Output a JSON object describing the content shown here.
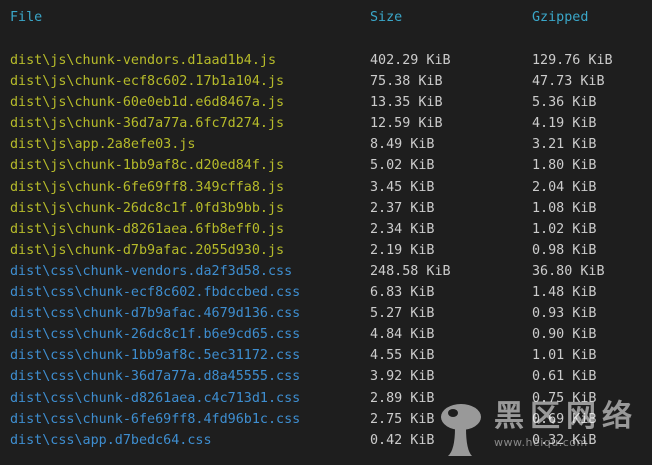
{
  "header": {
    "file_label": "File",
    "size_label": "Size",
    "gzipped_label": "Gzipped"
  },
  "colors": {
    "background": "#1e1e1e",
    "header": "#3aa7c9",
    "js_file": "#b6bb2a",
    "css_file": "#3e8ed0",
    "value": "#cccccc"
  },
  "rows": [
    {
      "file": "dist\\js\\chunk-vendors.d1aad1b4.js",
      "size": "402.29 KiB",
      "gzipped": "129.76 KiB",
      "kind": "js"
    },
    {
      "file": "dist\\js\\chunk-ecf8c602.17b1a104.js",
      "size": "75.38 KiB",
      "gzipped": "47.73 KiB",
      "kind": "js"
    },
    {
      "file": "dist\\js\\chunk-60e0eb1d.e6d8467a.js",
      "size": "13.35 KiB",
      "gzipped": "5.36 KiB",
      "kind": "js"
    },
    {
      "file": "dist\\js\\chunk-36d7a77a.6fc7d274.js",
      "size": "12.59 KiB",
      "gzipped": "4.19 KiB",
      "kind": "js"
    },
    {
      "file": "dist\\js\\app.2a8efe03.js",
      "size": "8.49 KiB",
      "gzipped": "3.21 KiB",
      "kind": "js"
    },
    {
      "file": "dist\\js\\chunk-1bb9af8c.d20ed84f.js",
      "size": "5.02 KiB",
      "gzipped": "1.80 KiB",
      "kind": "js"
    },
    {
      "file": "dist\\js\\chunk-6fe69ff8.349cffa8.js",
      "size": "3.45 KiB",
      "gzipped": "2.04 KiB",
      "kind": "js"
    },
    {
      "file": "dist\\js\\chunk-26dc8c1f.0fd3b9bb.js",
      "size": "2.37 KiB",
      "gzipped": "1.08 KiB",
      "kind": "js"
    },
    {
      "file": "dist\\js\\chunk-d8261aea.6fb8eff0.js",
      "size": "2.34 KiB",
      "gzipped": "1.02 KiB",
      "kind": "js"
    },
    {
      "file": "dist\\js\\chunk-d7b9afac.2055d930.js",
      "size": "2.19 KiB",
      "gzipped": "0.98 KiB",
      "kind": "js"
    },
    {
      "file": "dist\\css\\chunk-vendors.da2f3d58.css",
      "size": "248.58 KiB",
      "gzipped": "36.80 KiB",
      "kind": "css"
    },
    {
      "file": "dist\\css\\chunk-ecf8c602.fbdccbed.css",
      "size": "6.83 KiB",
      "gzipped": "1.48 KiB",
      "kind": "css"
    },
    {
      "file": "dist\\css\\chunk-d7b9afac.4679d136.css",
      "size": "5.27 KiB",
      "gzipped": "0.93 KiB",
      "kind": "css"
    },
    {
      "file": "dist\\css\\chunk-26dc8c1f.b6e9cd65.css",
      "size": "4.84 KiB",
      "gzipped": "0.90 KiB",
      "kind": "css"
    },
    {
      "file": "dist\\css\\chunk-1bb9af8c.5ec31172.css",
      "size": "4.55 KiB",
      "gzipped": "1.01 KiB",
      "kind": "css"
    },
    {
      "file": "dist\\css\\chunk-36d7a77a.d8a45555.css",
      "size": "3.92 KiB",
      "gzipped": "0.61 KiB",
      "kind": "css"
    },
    {
      "file": "dist\\css\\chunk-d8261aea.c4c713d1.css",
      "size": "2.89 KiB",
      "gzipped": "0.75 KiB",
      "kind": "css"
    },
    {
      "file": "dist\\css\\chunk-6fe69ff8.4fd96b1c.css",
      "size": "2.75 KiB",
      "gzipped": "0.69 KiB",
      "kind": "css"
    },
    {
      "file": "dist\\css\\app.d7bedc64.css",
      "size": "0.42 KiB",
      "gzipped": "0.32 KiB",
      "kind": "css"
    }
  ],
  "watermark": {
    "text": "黑区网络",
    "url": "www.heiqu.com",
    "logo": "mushroom-logo-icon"
  }
}
